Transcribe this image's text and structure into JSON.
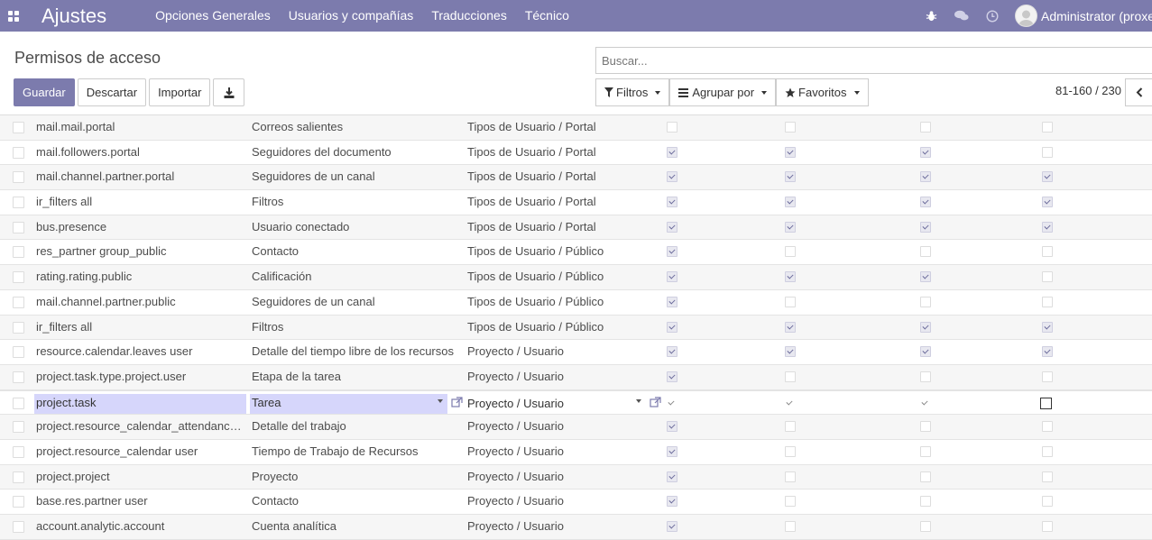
{
  "navbar": {
    "app_title": "Ajustes",
    "menu": [
      "Opciones Generales",
      "Usuarios y compañías",
      "Traducciones",
      "Técnico"
    ],
    "user_name": "Administrator (proxec"
  },
  "control_panel": {
    "breadcrumb": "Permisos de acceso",
    "search_placeholder": "Buscar...",
    "buttons": {
      "save": "Guardar",
      "discard": "Descartar",
      "import": "Importar"
    },
    "filters": "Filtros",
    "group_by": "Agrupar por",
    "favorites": "Favoritos",
    "pager": "81-160 / 230"
  },
  "rows": [
    {
      "model": "mail.mail.portal",
      "name": "Correos salientes",
      "group": "Tipos de Usuario / Portal",
      "perms": [
        false,
        false,
        false,
        false
      ]
    },
    {
      "model": "mail.followers.portal",
      "name": "Seguidores del documento",
      "group": "Tipos de Usuario / Portal",
      "perms": [
        true,
        true,
        true,
        false
      ]
    },
    {
      "model": "mail.channel.partner.portal",
      "name": "Seguidores de un canal",
      "group": "Tipos de Usuario / Portal",
      "perms": [
        true,
        true,
        true,
        true
      ]
    },
    {
      "model": "ir_filters all",
      "name": "Filtros",
      "group": "Tipos de Usuario / Portal",
      "perms": [
        true,
        true,
        true,
        true
      ]
    },
    {
      "model": "bus.presence",
      "name": "Usuario conectado",
      "group": "Tipos de Usuario / Portal",
      "perms": [
        true,
        true,
        true,
        true
      ]
    },
    {
      "model": "res_partner group_public",
      "name": "Contacto",
      "group": "Tipos de Usuario / Público",
      "perms": [
        true,
        false,
        false,
        false
      ]
    },
    {
      "model": "rating.rating.public",
      "name": "Calificación",
      "group": "Tipos de Usuario / Público",
      "perms": [
        true,
        true,
        true,
        false
      ]
    },
    {
      "model": "mail.channel.partner.public",
      "name": "Seguidores de un canal",
      "group": "Tipos de Usuario / Público",
      "perms": [
        true,
        false,
        false,
        false
      ]
    },
    {
      "model": "ir_filters all",
      "name": "Filtros",
      "group": "Tipos de Usuario / Público",
      "perms": [
        true,
        true,
        true,
        true
      ]
    },
    {
      "model": "resource.calendar.leaves user",
      "name": "Detalle del tiempo libre de los recursos",
      "group": "Proyecto / Usuario",
      "perms": [
        true,
        true,
        true,
        true
      ]
    },
    {
      "model": "project.task.type.project.user",
      "name": "Etapa de la tarea",
      "group": "Proyecto / Usuario",
      "perms": [
        true,
        false,
        false,
        false
      ]
    },
    {
      "model": "project.task",
      "name": "Tarea",
      "group": "Proyecto / Usuario",
      "perms": [
        true,
        true,
        true,
        false
      ],
      "editing": true
    },
    {
      "model": "project.resource_calendar_attendanc…",
      "name": "Detalle del trabajo",
      "group": "Proyecto / Usuario",
      "perms": [
        true,
        false,
        false,
        false
      ]
    },
    {
      "model": "project.resource_calendar user",
      "name": "Tiempo de Trabajo de Recursos",
      "group": "Proyecto / Usuario",
      "perms": [
        true,
        false,
        false,
        false
      ]
    },
    {
      "model": "project.project",
      "name": "Proyecto",
      "group": "Proyecto / Usuario",
      "perms": [
        true,
        false,
        false,
        false
      ]
    },
    {
      "model": "base.res.partner user",
      "name": "Contacto",
      "group": "Proyecto / Usuario",
      "perms": [
        true,
        false,
        false,
        false
      ]
    },
    {
      "model": "account.analytic.account",
      "name": "Cuenta analítica",
      "group": "Proyecto / Usuario",
      "perms": [
        true,
        false,
        false,
        false
      ]
    }
  ]
}
